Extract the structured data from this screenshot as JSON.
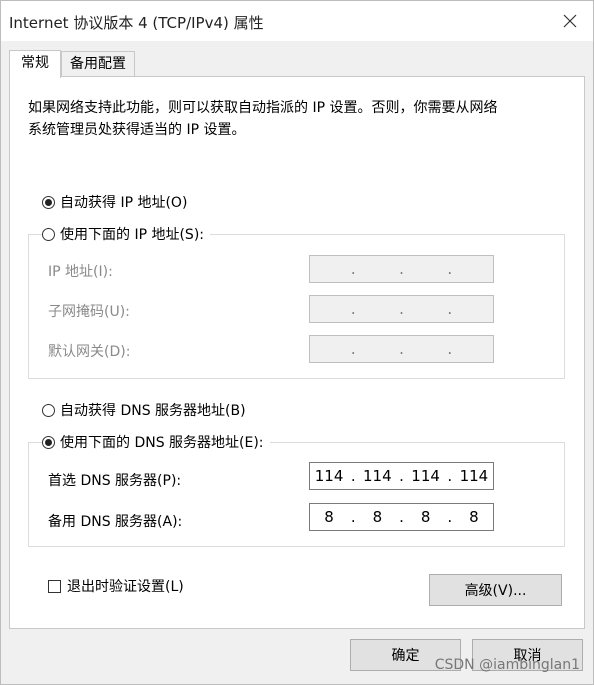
{
  "window": {
    "title": "Internet 协议版本 4 (TCP/IPv4) 属性"
  },
  "tabs": [
    {
      "label": "常规"
    },
    {
      "label": "备用配置"
    }
  ],
  "description": {
    "line1": "如果网络支持此功能，则可以获取自动指派的 IP 设置。否则，你需要从网络",
    "line2": "系统管理员处获得适当的 IP 设置。"
  },
  "ip": {
    "auto_label": "自动获得 IP 地址(O)",
    "auto_selected": true,
    "manual_label": "使用下面的 IP 地址(S):",
    "fields": [
      {
        "label": "IP 地址(I):",
        "octets": [
          "",
          "",
          "",
          ""
        ]
      },
      {
        "label": "子网掩码(U):",
        "octets": [
          "",
          "",
          "",
          ""
        ]
      },
      {
        "label": "默认网关(D):",
        "octets": [
          "",
          "",
          "",
          ""
        ]
      }
    ],
    "dot": "."
  },
  "dns": {
    "auto_label": "自动获得 DNS 服务器地址(B)",
    "manual_label": "使用下面的 DNS 服务器地址(E):",
    "manual_selected": true,
    "fields": [
      {
        "label": "首选 DNS 服务器(P):",
        "octets": [
          "114",
          "114",
          "114",
          "114"
        ]
      },
      {
        "label": "备用 DNS 服务器(A):",
        "octets": [
          "8",
          "8",
          "8",
          "8"
        ]
      }
    ],
    "dot": "."
  },
  "validate": {
    "label": "退出时验证设置(L)",
    "checked": false
  },
  "buttons": {
    "advanced": "高级(V)...",
    "ok": "确定",
    "cancel": "取消"
  },
  "watermark": "CSDN @iambinglan1",
  "icons": {
    "close": "close-icon"
  }
}
